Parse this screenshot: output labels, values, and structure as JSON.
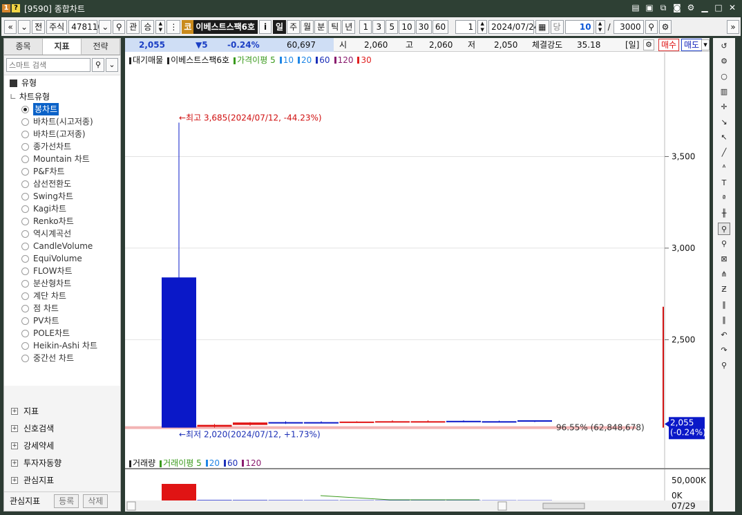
{
  "window": {
    "badge1": "1",
    "badge2": "?",
    "title": "[9590] 종합차트"
  },
  "toolbar": {
    "prev": "«",
    "next": "»",
    "jeon": "전",
    "market": "주식",
    "code": "478110",
    "gwan": "관",
    "seung": "승",
    "stock_badge": "코",
    "stock_name": "이베스트스팩6호",
    "info_i": "i",
    "periods": [
      "일",
      "주",
      "월",
      "분",
      "틱",
      "년"
    ],
    "active_period": "일",
    "numbers": [
      "1",
      "3",
      "5",
      "10",
      "30",
      "60"
    ],
    "count_sel": "1",
    "date": "2024/07/24",
    "dang": "당",
    "unit": "10",
    "slash": "/",
    "total": "3000",
    "more": "»"
  },
  "left": {
    "tabs": [
      "종목",
      "지표",
      "전략"
    ],
    "active_tab": "지표",
    "search_placeholder": "스마트 검색",
    "tree_head": "유형",
    "tree_sub": "차트유형",
    "chart_types": [
      "봉차트",
      "바차트(시고저종)",
      "바차트(고저종)",
      "종가선차트",
      "Mountain 차트",
      "P&F차트",
      "삼선전환도",
      "Swing차트",
      "Kagi차트",
      "Renko차트",
      "역시계곡선",
      "CandleVolume",
      "EquiVolume",
      "FLOW차트",
      "분산형차트",
      "계단 차트",
      "점 차트",
      "PV차트",
      "POLE차트",
      "Heikin-Ashi 차트",
      "중간선 차트"
    ],
    "selected_type": "봉차트",
    "sections": [
      "지표",
      "신호검색",
      "강세약세",
      "투자자동향",
      "관심지표"
    ],
    "footer_label": "관심지표",
    "btn_register": "등록",
    "btn_delete": "삭제"
  },
  "infobar": {
    "price": "2,055",
    "change": "▼5",
    "change_pct": "-0.24%",
    "volume": "60,697",
    "open_label": "시",
    "open": "2,060",
    "high_label": "고",
    "high": "2,060",
    "low_label": "저",
    "low": "2,050",
    "strength_label": "체결강도",
    "strength": "35.18",
    "period_tag": "[일]",
    "buy": "매수",
    "sell": "매도"
  },
  "legend": {
    "title": "대기매물",
    "name": "이베스트스팩6호",
    "ma_label": "가격이평",
    "ma_periods": [
      "5",
      "10",
      "20",
      "60",
      "120",
      "30"
    ],
    "ma_colors": [
      "#3a9a1c",
      "#1f86e6",
      "#1f86e6",
      "#1c2fb8",
      "#8a1c6e",
      "#e02020"
    ]
  },
  "volume_legend": {
    "title": "거래량",
    "ma_label": "거래이평",
    "ma_periods": [
      "5",
      "20",
      "60",
      "120"
    ],
    "ma_colors": [
      "#3a9a1c",
      "#1f86e6",
      "#1c2fb8",
      "#8a1c6e"
    ]
  },
  "annotations": {
    "high": "←최고 3,685(2024/07/12, -44.23%)",
    "low": "←최저 2,020(2024/07/12, +1.73%)",
    "pct_left": "96.55% (62,848,678)",
    "price_tag": "2,055",
    "price_tag_pct": "(-0.24%)"
  },
  "volume_axis": [
    "50,000K",
    "0K"
  ],
  "date_label": "07/29",
  "chart_data": {
    "type": "bar",
    "title": "",
    "subtitle": "",
    "xlabel": "",
    "ylabel": "",
    "ylim": [
      1860,
      4030
    ],
    "yticks": [
      2500,
      3000,
      3500
    ],
    "ytick_labels": [
      "2,500",
      "3,000",
      "3,500"
    ],
    "candles": [
      {
        "open": 2840,
        "high": 3685,
        "low": 2020,
        "close": 2020,
        "color": "#0a18c8"
      },
      {
        "open": 2025,
        "high": 2040,
        "low": 2020,
        "close": 2035,
        "color": "#e01414"
      },
      {
        "open": 2035,
        "high": 2050,
        "low": 2030,
        "close": 2048,
        "color": "#e01414"
      },
      {
        "open": 2050,
        "high": 2055,
        "low": 2040,
        "close": 2045,
        "color": "#0a18c8"
      },
      {
        "open": 2048,
        "high": 2055,
        "low": 2045,
        "close": 2050,
        "color": "#0a18c8"
      },
      {
        "open": 2050,
        "high": 2055,
        "low": 2048,
        "close": 2053,
        "color": "#e01414"
      },
      {
        "open": 2053,
        "high": 2060,
        "low": 2050,
        "close": 2055,
        "color": "#e01414"
      },
      {
        "open": 2055,
        "high": 2060,
        "low": 2050,
        "close": 2055,
        "color": "#e01414"
      },
      {
        "open": 2057,
        "high": 2060,
        "low": 2050,
        "close": 2052,
        "color": "#0a18c8"
      },
      {
        "open": 2055,
        "high": 2058,
        "low": 2050,
        "close": 2053,
        "color": "#0a18c8"
      },
      {
        "open": 2060,
        "high": 2060,
        "low": 2050,
        "close": 2055,
        "color": "#0a18c8"
      }
    ],
    "volume": {
      "ylim": [
        0,
        50000
      ],
      "values": [
        40000,
        1200,
        1100,
        900,
        800,
        700,
        700,
        600,
        600,
        600,
        550
      ],
      "colors": [
        "#e01414",
        "#0a18c8",
        "#0a18c8",
        "#0a18c8",
        "#0a18c8",
        "#0a18c8",
        "#0a18c8",
        "#0a18c8",
        "#0a18c8",
        "#0a18c8",
        "#0a18c8"
      ]
    }
  },
  "right_tools": [
    "reset-icon",
    "gear-icon",
    "circle-icon",
    "chart-icon",
    "cross-icon",
    "trend-down-icon",
    "trend-up-icon",
    "line-icon",
    "auto-icon",
    "text-icon",
    "abc-icon",
    "candle-icon",
    "zoom-info-icon",
    "zoom-list-icon",
    "zoom-area-icon",
    "pattern-icon",
    "n-icon",
    "bars-icon",
    "bars2-icon",
    "undo-icon",
    "redo-icon",
    "search-icon"
  ]
}
